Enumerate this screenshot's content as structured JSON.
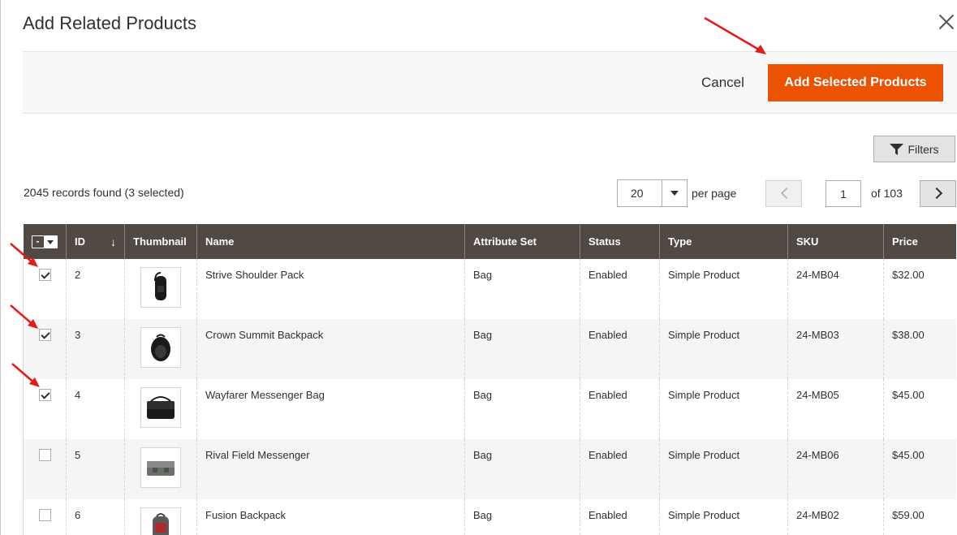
{
  "modal": {
    "title": "Add Related Products",
    "close_icon": "close-icon"
  },
  "toolbar": {
    "cancel_label": "Cancel",
    "add_label": "Add Selected Products"
  },
  "filters": {
    "label": "Filters",
    "icon": "funnel-icon"
  },
  "grid_info": {
    "records_text": "2045 records found (3 selected)",
    "per_page_value": "20",
    "per_page_label": "per page",
    "current_page": "1",
    "of_pages": "of 103"
  },
  "columns": [
    "ID",
    "Thumbnail",
    "Name",
    "Attribute Set",
    "Status",
    "Type",
    "SKU",
    "Price"
  ],
  "rows": [
    {
      "checked": true,
      "id": "2",
      "name": "Strive Shoulder Pack",
      "attribute_set": "Bag",
      "status": "Enabled",
      "type": "Simple Product",
      "sku": "24-MB04",
      "price": "$32.00",
      "thumb": "shoulder-pack-thumbnail"
    },
    {
      "checked": true,
      "id": "3",
      "name": "Crown Summit Backpack",
      "attribute_set": "Bag",
      "status": "Enabled",
      "type": "Simple Product",
      "sku": "24-MB03",
      "price": "$38.00",
      "thumb": "backpack-thumbnail"
    },
    {
      "checked": true,
      "id": "4",
      "name": "Wayfarer Messenger Bag",
      "attribute_set": "Bag",
      "status": "Enabled",
      "type": "Simple Product",
      "sku": "24-MB05",
      "price": "$45.00",
      "thumb": "messenger-bag-thumbnail"
    },
    {
      "checked": false,
      "id": "5",
      "name": "Rival Field Messenger",
      "attribute_set": "Bag",
      "status": "Enabled",
      "type": "Simple Product",
      "sku": "24-MB06",
      "price": "$45.00",
      "thumb": "field-messenger-thumbnail"
    },
    {
      "checked": false,
      "id": "6",
      "name": "Fusion Backpack",
      "attribute_set": "Bag",
      "status": "Enabled",
      "type": "Simple Product",
      "sku": "24-MB02",
      "price": "$59.00",
      "thumb": "fusion-backpack-thumbnail"
    }
  ],
  "colors": {
    "primary_button": "#eb5202",
    "table_header": "#514943",
    "annotation_arrow": "#e41b17"
  }
}
